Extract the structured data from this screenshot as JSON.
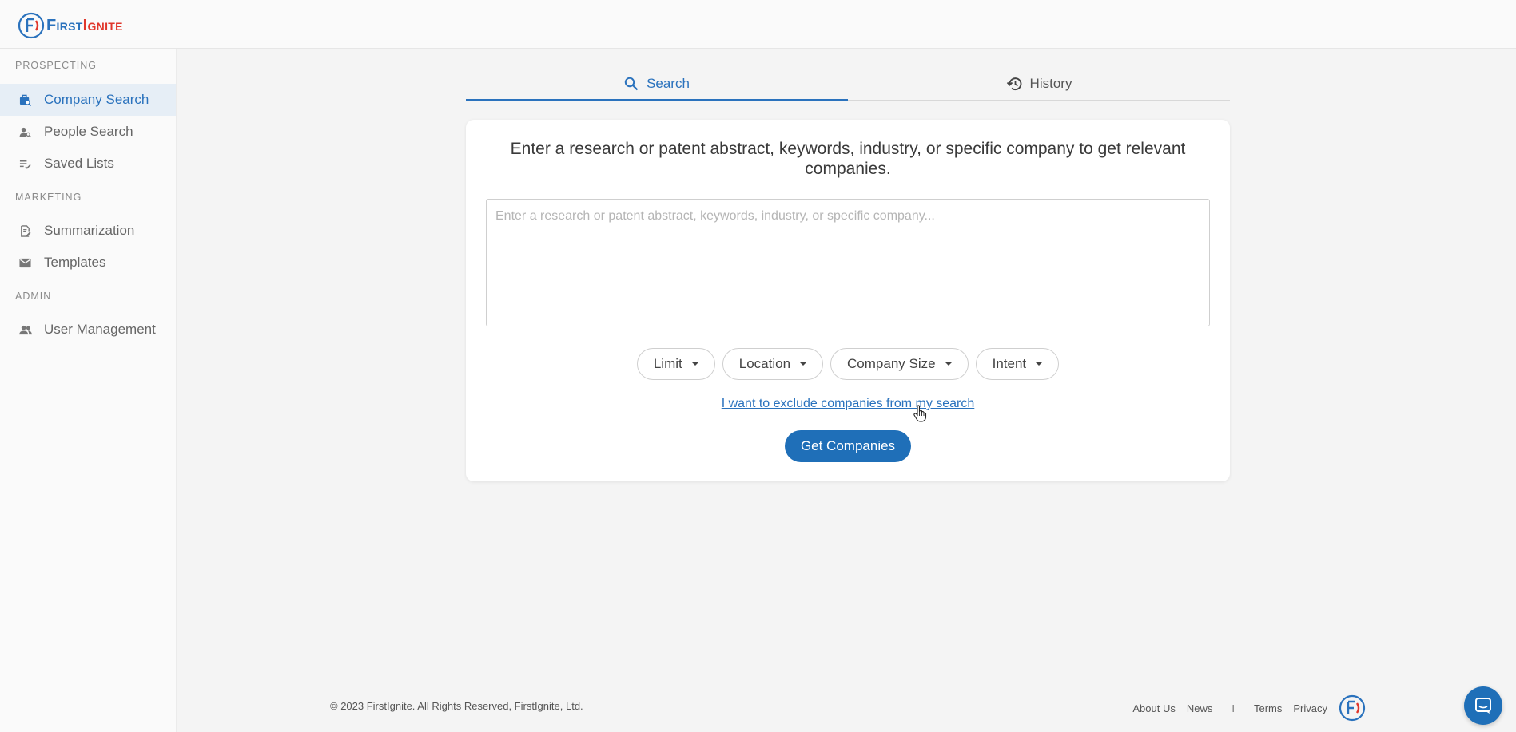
{
  "brand": {
    "first": "First",
    "ignite": "Ignite",
    "primary_color": "#2a72bd",
    "accent_color": "#e0362b"
  },
  "sidebar": {
    "sections": [
      {
        "label": "PROSPECTING",
        "items": [
          {
            "label": "Company Search",
            "icon": "company-search-icon",
            "active": true
          },
          {
            "label": "People Search",
            "icon": "person-search-icon"
          },
          {
            "label": "Saved Lists",
            "icon": "checklist-icon"
          }
        ]
      },
      {
        "label": "MARKETING",
        "items": [
          {
            "label": "Summarization",
            "icon": "edit-document-icon"
          },
          {
            "label": "Templates",
            "icon": "mail-icon"
          }
        ]
      },
      {
        "label": "ADMIN",
        "items": [
          {
            "label": "User Management",
            "icon": "users-icon"
          }
        ]
      }
    ]
  },
  "tabs": [
    {
      "label": "Search",
      "icon": "search-icon",
      "active": true
    },
    {
      "label": "History",
      "icon": "history-icon"
    }
  ],
  "search_card": {
    "title": "Enter a research or patent abstract, keywords, industry, or specific company to get relevant companies.",
    "placeholder": "Enter a research or patent abstract, keywords, industry, or specific company...",
    "value": "",
    "filters": [
      "Limit",
      "Location",
      "Company Size",
      "Intent"
    ],
    "exclude_link": "I want to exclude companies from my search",
    "submit_label": "Get Companies"
  },
  "footer": {
    "copyright": "© 2023 FirstIgnite. All Rights Reserved, FirstIgnite, Ltd.",
    "links": [
      "About Us",
      "News",
      "Terms",
      "Privacy"
    ],
    "separator": "I"
  }
}
